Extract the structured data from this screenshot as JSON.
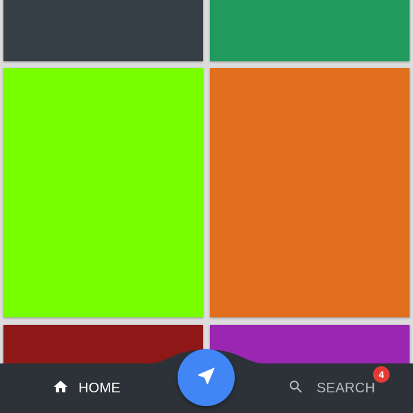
{
  "tiles": [
    {
      "color": "#363e46"
    },
    {
      "color": "#219a5e"
    },
    {
      "color": "#77ff00"
    },
    {
      "color": "#e16f1e"
    },
    {
      "color": "#8e1818"
    },
    {
      "color": "#9b26b2"
    }
  ],
  "bottom_nav": {
    "background": "#2c3238",
    "home": {
      "label": "HOME",
      "icon": "home-icon"
    },
    "search": {
      "label": "SEARCH",
      "icon": "search-icon",
      "badge": "4"
    },
    "fab": {
      "icon": "navigation-arrow-icon",
      "color": "#4285f4"
    }
  }
}
